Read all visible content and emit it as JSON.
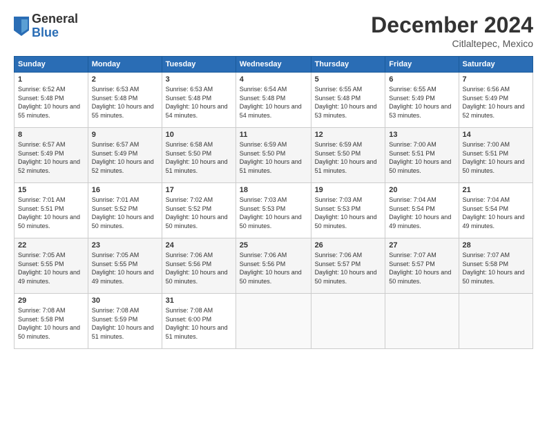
{
  "header": {
    "logo_line1": "General",
    "logo_line2": "Blue",
    "month": "December 2024",
    "location": "Citlaltepec, Mexico"
  },
  "weekdays": [
    "Sunday",
    "Monday",
    "Tuesday",
    "Wednesday",
    "Thursday",
    "Friday",
    "Saturday"
  ],
  "weeks": [
    [
      {
        "day": "1",
        "sunrise": "6:52 AM",
        "sunset": "5:48 PM",
        "daylight": "10 hours and 55 minutes."
      },
      {
        "day": "2",
        "sunrise": "6:53 AM",
        "sunset": "5:48 PM",
        "daylight": "10 hours and 55 minutes."
      },
      {
        "day": "3",
        "sunrise": "6:53 AM",
        "sunset": "5:48 PM",
        "daylight": "10 hours and 54 minutes."
      },
      {
        "day": "4",
        "sunrise": "6:54 AM",
        "sunset": "5:48 PM",
        "daylight": "10 hours and 54 minutes."
      },
      {
        "day": "5",
        "sunrise": "6:55 AM",
        "sunset": "5:48 PM",
        "daylight": "10 hours and 53 minutes."
      },
      {
        "day": "6",
        "sunrise": "6:55 AM",
        "sunset": "5:49 PM",
        "daylight": "10 hours and 53 minutes."
      },
      {
        "day": "7",
        "sunrise": "6:56 AM",
        "sunset": "5:49 PM",
        "daylight": "10 hours and 52 minutes."
      }
    ],
    [
      {
        "day": "8",
        "sunrise": "6:57 AM",
        "sunset": "5:49 PM",
        "daylight": "10 hours and 52 minutes."
      },
      {
        "day": "9",
        "sunrise": "6:57 AM",
        "sunset": "5:49 PM",
        "daylight": "10 hours and 52 minutes."
      },
      {
        "day": "10",
        "sunrise": "6:58 AM",
        "sunset": "5:50 PM",
        "daylight": "10 hours and 51 minutes."
      },
      {
        "day": "11",
        "sunrise": "6:59 AM",
        "sunset": "5:50 PM",
        "daylight": "10 hours and 51 minutes."
      },
      {
        "day": "12",
        "sunrise": "6:59 AM",
        "sunset": "5:50 PM",
        "daylight": "10 hours and 51 minutes."
      },
      {
        "day": "13",
        "sunrise": "7:00 AM",
        "sunset": "5:51 PM",
        "daylight": "10 hours and 50 minutes."
      },
      {
        "day": "14",
        "sunrise": "7:00 AM",
        "sunset": "5:51 PM",
        "daylight": "10 hours and 50 minutes."
      }
    ],
    [
      {
        "day": "15",
        "sunrise": "7:01 AM",
        "sunset": "5:51 PM",
        "daylight": "10 hours and 50 minutes."
      },
      {
        "day": "16",
        "sunrise": "7:01 AM",
        "sunset": "5:52 PM",
        "daylight": "10 hours and 50 minutes."
      },
      {
        "day": "17",
        "sunrise": "7:02 AM",
        "sunset": "5:52 PM",
        "daylight": "10 hours and 50 minutes."
      },
      {
        "day": "18",
        "sunrise": "7:03 AM",
        "sunset": "5:53 PM",
        "daylight": "10 hours and 50 minutes."
      },
      {
        "day": "19",
        "sunrise": "7:03 AM",
        "sunset": "5:53 PM",
        "daylight": "10 hours and 50 minutes."
      },
      {
        "day": "20",
        "sunrise": "7:04 AM",
        "sunset": "5:54 PM",
        "daylight": "10 hours and 49 minutes."
      },
      {
        "day": "21",
        "sunrise": "7:04 AM",
        "sunset": "5:54 PM",
        "daylight": "10 hours and 49 minutes."
      }
    ],
    [
      {
        "day": "22",
        "sunrise": "7:05 AM",
        "sunset": "5:55 PM",
        "daylight": "10 hours and 49 minutes."
      },
      {
        "day": "23",
        "sunrise": "7:05 AM",
        "sunset": "5:55 PM",
        "daylight": "10 hours and 49 minutes."
      },
      {
        "day": "24",
        "sunrise": "7:06 AM",
        "sunset": "5:56 PM",
        "daylight": "10 hours and 50 minutes."
      },
      {
        "day": "25",
        "sunrise": "7:06 AM",
        "sunset": "5:56 PM",
        "daylight": "10 hours and 50 minutes."
      },
      {
        "day": "26",
        "sunrise": "7:06 AM",
        "sunset": "5:57 PM",
        "daylight": "10 hours and 50 minutes."
      },
      {
        "day": "27",
        "sunrise": "7:07 AM",
        "sunset": "5:57 PM",
        "daylight": "10 hours and 50 minutes."
      },
      {
        "day": "28",
        "sunrise": "7:07 AM",
        "sunset": "5:58 PM",
        "daylight": "10 hours and 50 minutes."
      }
    ],
    [
      {
        "day": "29",
        "sunrise": "7:08 AM",
        "sunset": "5:58 PM",
        "daylight": "10 hours and 50 minutes."
      },
      {
        "day": "30",
        "sunrise": "7:08 AM",
        "sunset": "5:59 PM",
        "daylight": "10 hours and 51 minutes."
      },
      {
        "day": "31",
        "sunrise": "7:08 AM",
        "sunset": "6:00 PM",
        "daylight": "10 hours and 51 minutes."
      },
      null,
      null,
      null,
      null
    ]
  ]
}
